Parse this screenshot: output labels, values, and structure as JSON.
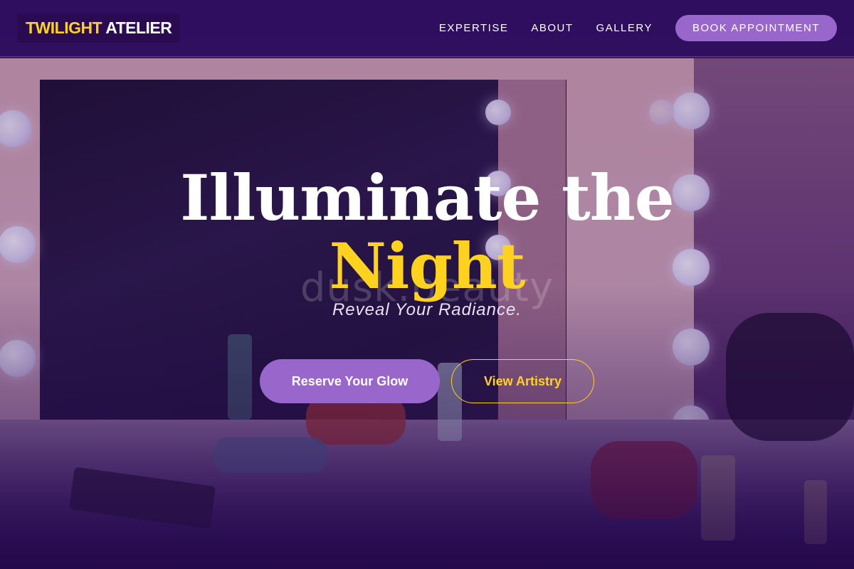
{
  "brand": {
    "logo_part1": "TWILIGHT",
    "logo_part2": "ATELIER",
    "accent_color": "#ffd21f",
    "primary_color": "#9966cc",
    "nav_background": "#300e5f"
  },
  "nav": {
    "links": [
      "EXPERTISE",
      "ABOUT",
      "GALLERY"
    ],
    "cta_label": "BOOK APPOINTMENT"
  },
  "hero": {
    "headline": "Illuminate the",
    "headline_accent": "Night",
    "tagline": "Reveal Your Radiance.",
    "watermark": "dusk.beauty",
    "primary_button": "Reserve Your Glow",
    "secondary_button": "View Artistry",
    "background_image": "vanity-mirror-with-lights"
  }
}
